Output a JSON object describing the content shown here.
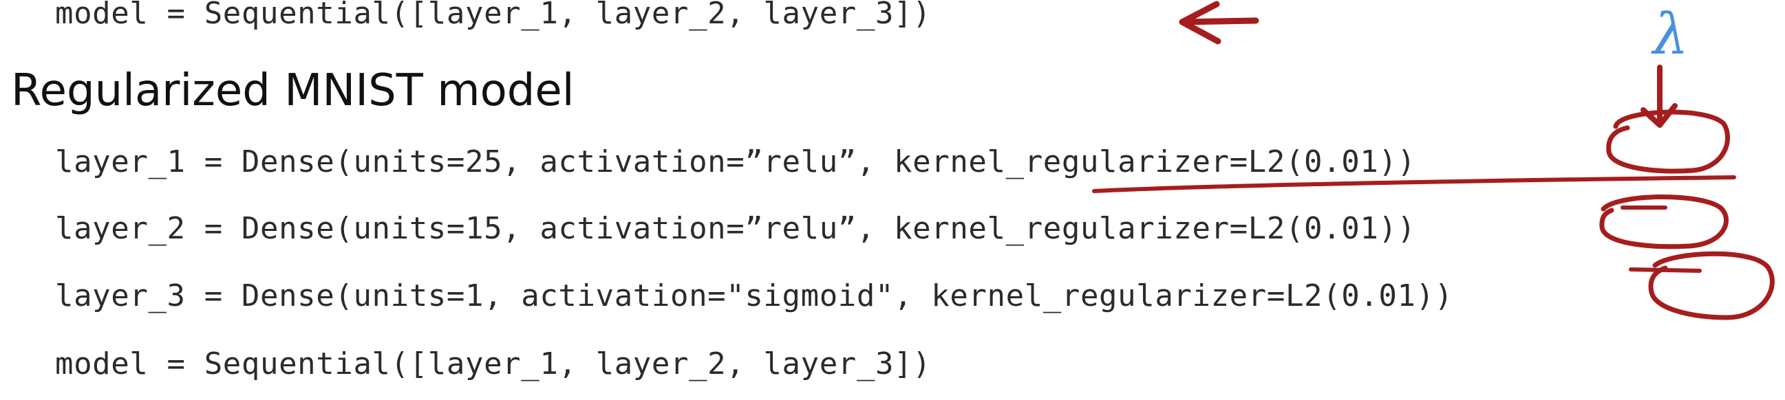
{
  "heading": "Regularized MNIST model",
  "code_lines": [
    "model = Sequential([layer_1, layer_2, layer_3])",
    "layer_1 = Dense(units=25, activation=”relu”, kernel_regularizer=L2(0.01))",
    "layer_2 = Dense(units=15, activation=”relu”, kernel_regularizer=L2(0.01))",
    "layer_3 = Dense(units=1, activation=\"sigmoid\", kernel_regularizer=L2(0.01))",
    "model = Sequential([layer_1, layer_2, layer_3])"
  ],
  "annotations": {
    "lambda_symbol": "λ",
    "ink_red": "#a61d1d",
    "ink_blue": "#4a8fe0"
  }
}
